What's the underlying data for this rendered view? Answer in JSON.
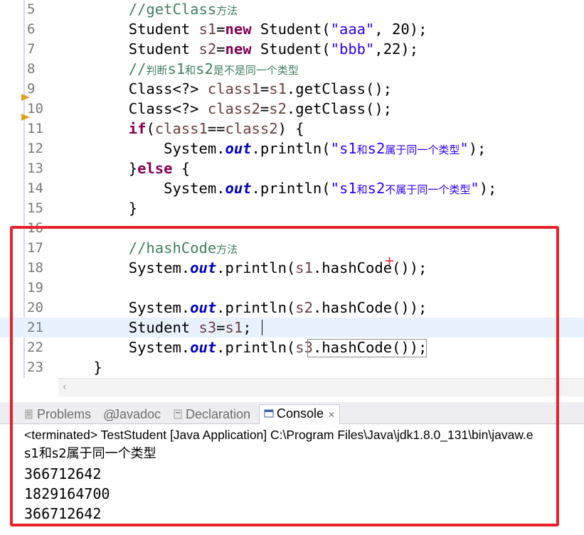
{
  "editor": {
    "lines": [
      {
        "n": "5",
        "parts": [
          [
            "cm",
            "        //getClass"
          ],
          [
            "cmcjk",
            "方法"
          ]
        ]
      },
      {
        "n": "6",
        "parts": [
          [
            "",
            "        Student "
          ],
          [
            "var",
            "s1"
          ],
          [
            "",
            "="
          ],
          [
            "kw",
            "new"
          ],
          [
            "",
            " Student("
          ],
          [
            "str",
            "\"aaa\""
          ],
          [
            "",
            ", 20);"
          ]
        ]
      },
      {
        "n": "7",
        "parts": [
          [
            "",
            "        Student "
          ],
          [
            "var",
            "s2"
          ],
          [
            "",
            "="
          ],
          [
            "kw",
            "new"
          ],
          [
            "",
            " Student("
          ],
          [
            "str",
            "\"bbb\""
          ],
          [
            "",
            ",22);"
          ]
        ]
      },
      {
        "n": "8",
        "parts": [
          [
            "cm",
            "        //"
          ],
          [
            "cmcjk",
            "判断"
          ],
          [
            "cm",
            "s1"
          ],
          [
            "cmcjk",
            "和"
          ],
          [
            "cm",
            "s2"
          ],
          [
            "cmcjk",
            "是不是同一个类型"
          ]
        ]
      },
      {
        "n": "9",
        "parts": [
          [
            "",
            "        Class<?> "
          ],
          [
            "var",
            "class1"
          ],
          [
            "",
            "="
          ],
          [
            "var",
            "s1"
          ],
          [
            "",
            ".getClass();"
          ]
        ]
      },
      {
        "n": "10",
        "parts": [
          [
            "",
            "        Class<?> "
          ],
          [
            "var",
            "class2"
          ],
          [
            "",
            "="
          ],
          [
            "var",
            "s2"
          ],
          [
            "",
            ".getClass();"
          ]
        ]
      },
      {
        "n": "11",
        "parts": [
          [
            "",
            "        "
          ],
          [
            "kw",
            "if"
          ],
          [
            "",
            "("
          ],
          [
            "var",
            "class1"
          ],
          [
            "",
            "=="
          ],
          [
            "var",
            "class2"
          ],
          [
            "",
            ") {"
          ]
        ]
      },
      {
        "n": "12",
        "parts": [
          [
            "",
            "            System."
          ],
          [
            "fld",
            "out"
          ],
          [
            "",
            ".println("
          ],
          [
            "str",
            "\"s1"
          ],
          [
            "strcjk",
            "和"
          ],
          [
            "str",
            "s2"
          ],
          [
            "strcjk",
            "属于同一个类型"
          ],
          [
            "str",
            "\""
          ],
          [
            "",
            ");"
          ]
        ]
      },
      {
        "n": "13",
        "parts": [
          [
            "",
            "        }"
          ],
          [
            "kw",
            "else"
          ],
          [
            "",
            " {"
          ]
        ]
      },
      {
        "n": "14",
        "parts": [
          [
            "",
            "            System."
          ],
          [
            "fld",
            "out"
          ],
          [
            "",
            ".println("
          ],
          [
            "str",
            "\"s1"
          ],
          [
            "strcjk",
            "和"
          ],
          [
            "str",
            "s2"
          ],
          [
            "strcjk",
            "不属于同一个类型"
          ],
          [
            "str",
            "\""
          ],
          [
            "",
            ");"
          ]
        ]
      },
      {
        "n": "15",
        "parts": [
          [
            "",
            "        }"
          ]
        ]
      },
      {
        "n": "16",
        "parts": [
          [
            "",
            ""
          ]
        ]
      },
      {
        "n": "17",
        "parts": [
          [
            "cm",
            "        //hashCode"
          ],
          [
            "cmcjk",
            "方法"
          ]
        ]
      },
      {
        "n": "18",
        "parts": [
          [
            "",
            "        System."
          ],
          [
            "fld",
            "out"
          ],
          [
            "",
            ".println("
          ],
          [
            "var",
            "s1"
          ],
          [
            "",
            ".hashCode());"
          ]
        ]
      },
      {
        "n": "19",
        "parts": [
          [
            "",
            ""
          ]
        ]
      },
      {
        "n": "20",
        "parts": [
          [
            "",
            "        System."
          ],
          [
            "fld",
            "out"
          ],
          [
            "",
            ".println("
          ],
          [
            "var",
            "s2"
          ],
          [
            "",
            ".hashCode());"
          ]
        ]
      },
      {
        "n": "21",
        "parts": [
          [
            "",
            "        Student "
          ],
          [
            "var",
            "s3"
          ],
          [
            "",
            "="
          ],
          [
            "var",
            "s1"
          ],
          [
            "",
            ";"
          ]
        ]
      },
      {
        "n": "22",
        "parts": [
          [
            "",
            "        System."
          ],
          [
            "fld",
            "out"
          ],
          [
            "",
            ".println("
          ],
          [
            "var",
            "s3"
          ],
          [
            "",
            ".hashCode());"
          ]
        ]
      },
      {
        "n": "23",
        "parts": [
          [
            "",
            "    }"
          ]
        ]
      }
    ]
  },
  "tabs": {
    "problems": "Problems",
    "javadoc": "Javadoc",
    "declaration": "Declaration",
    "console": "Console"
  },
  "console": {
    "terminated": "<terminated> TestStudent [Java Application] C:\\Program Files\\Java\\jdk1.8.0_131\\bin\\javaw.e",
    "output": [
      "s1和s2属于同一个类型",
      "366712642",
      "1829164700",
      "366712642"
    ]
  },
  "colors": {
    "keyword": "#7f0055",
    "string": "#2a00ff",
    "comment": "#3f7f5f",
    "field": "#0000c0",
    "highlight_box": "#e8202a",
    "current_line": "#e8f2fe"
  }
}
